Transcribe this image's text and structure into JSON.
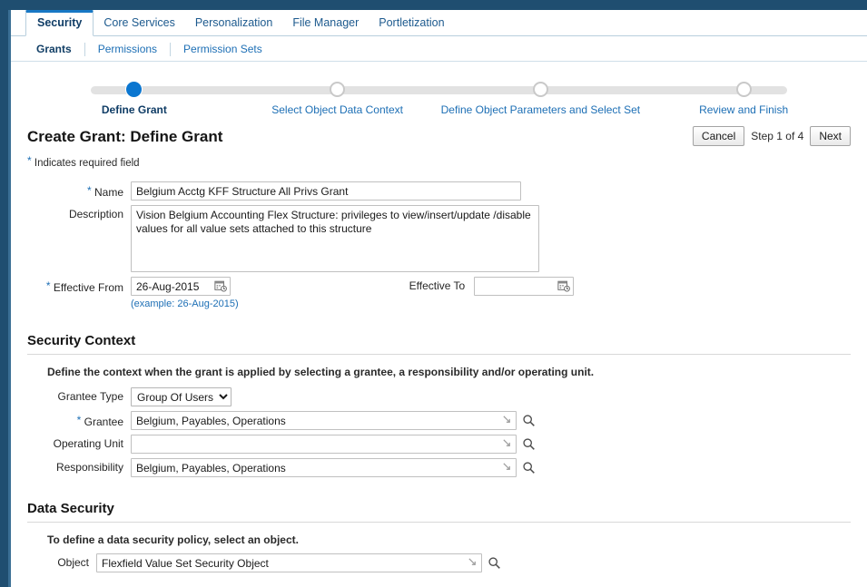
{
  "global_tabs": [
    {
      "label": "Security",
      "selected": true
    },
    {
      "label": "Core Services",
      "selected": false
    },
    {
      "label": "Personalization",
      "selected": false
    },
    {
      "label": "File Manager",
      "selected": false
    },
    {
      "label": "Portletization",
      "selected": false
    }
  ],
  "sub_tabs": [
    {
      "label": "Grants",
      "selected": true
    },
    {
      "label": "Permissions",
      "selected": false
    },
    {
      "label": "Permission Sets",
      "selected": false
    }
  ],
  "train": {
    "steps": [
      {
        "label": "Define Grant",
        "active": true
      },
      {
        "label": "Select Object Data Context",
        "active": false
      },
      {
        "label": "Define Object Parameters and Select Set",
        "active": false
      },
      {
        "label": "Review and Finish",
        "active": false
      }
    ]
  },
  "header": {
    "title": "Create Grant: Define Grant",
    "cancel_label": "Cancel",
    "step_text": "Step 1 of 4",
    "next_label": "Next",
    "required_note": "Indicates required field",
    "required_marker": "*"
  },
  "form": {
    "name": {
      "label": "Name",
      "required": true,
      "value": "Belgium Acctg KFF Structure All Privs Grant",
      "placeholder": ""
    },
    "description": {
      "label": "Description",
      "required": false,
      "value": "Vision Belgium Accounting Flex Structure: privileges to view/insert/update /disable values for all value sets attached to this structure",
      "placeholder": ""
    },
    "effective_from": {
      "label": "Effective From",
      "required": true,
      "value": "26-Aug-2015",
      "placeholder": "",
      "hint": "(example: 26-Aug-2015)",
      "icon": "calendar-icon"
    },
    "effective_to": {
      "label": "Effective To",
      "required": false,
      "value": "",
      "placeholder": "",
      "icon": "calendar-icon"
    }
  },
  "security_context": {
    "title": "Security Context",
    "description": "Define the context when the grant is applied by selecting a grantee, a responsibility and/or operating unit.",
    "grantee_type": {
      "label": "Grantee Type",
      "value": "Group Of Users",
      "options": [
        "Group Of Users"
      ]
    },
    "grantee": {
      "label": "Grantee",
      "required": true,
      "value": "Belgium, Payables, Operations",
      "placeholder": ""
    },
    "operating_unit": {
      "label": "Operating Unit",
      "required": false,
      "value": "",
      "placeholder": ""
    },
    "responsibility": {
      "label": "Responsibility",
      "required": false,
      "value": "Belgium, Payables, Operations",
      "placeholder": ""
    }
  },
  "data_security": {
    "title": "Data Security",
    "description": "To define a data security policy, select an object.",
    "object": {
      "label": "Object",
      "required": false,
      "value": "Flexfield Value Set Security Object",
      "placeholder": ""
    }
  },
  "icons": {
    "calendar": "calendar-icon",
    "lov_arrow": "lov-arrow-icon",
    "search": "search-icon",
    "dropdown": "chevron-down-icon"
  },
  "colors": {
    "chrome": "#1f4e70",
    "accent": "#1878c5",
    "link": "#1d6fb5",
    "active_node": "#0b76d0",
    "rail": "#e2e2e2"
  }
}
